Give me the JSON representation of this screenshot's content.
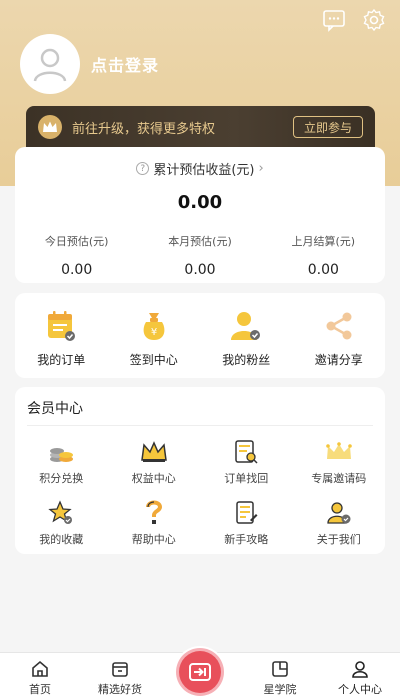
{
  "header": {
    "login_text": "点击登录",
    "icons": [
      "message-icon",
      "settings-icon"
    ]
  },
  "vip": {
    "text": "前往升级，获得更多特权",
    "button": "立即参与"
  },
  "earnings": {
    "title": "累计预估收益(元)",
    "total": "0.00",
    "cells": [
      {
        "label": "今日预估(元)",
        "value": "0.00"
      },
      {
        "label": "本月预估(元)",
        "value": "0.00"
      },
      {
        "label": "上月结算(元)",
        "value": "0.00"
      }
    ]
  },
  "quick": [
    {
      "label": "我的订单",
      "icon": "order-calendar-icon"
    },
    {
      "label": "签到中心",
      "icon": "money-bag-icon"
    },
    {
      "label": "我的粉丝",
      "icon": "fans-user-icon"
    },
    {
      "label": "邀请分享",
      "icon": "share-icon"
    }
  ],
  "member": {
    "title": "会员中心",
    "items": [
      {
        "label": "积分兑换",
        "icon": "coins-icon"
      },
      {
        "label": "权益中心",
        "icon": "crown-icon"
      },
      {
        "label": "订单找回",
        "icon": "order-search-icon"
      },
      {
        "label": "专属邀请码",
        "icon": "invite-crown-icon"
      },
      {
        "label": "我的收藏",
        "icon": "star-icon"
      },
      {
        "label": "帮助中心",
        "icon": "question-icon"
      },
      {
        "label": "新手攻略",
        "icon": "guide-icon"
      },
      {
        "label": "关于我们",
        "icon": "about-user-icon"
      }
    ]
  },
  "tabbar": {
    "items": [
      {
        "label": "首页",
        "icon": "home-icon"
      },
      {
        "label": "精选好货",
        "icon": "shop-icon"
      },
      {
        "label": "",
        "icon": "center-action-icon"
      },
      {
        "label": "星学院",
        "icon": "academy-icon"
      },
      {
        "label": "个人中心",
        "icon": "profile-icon",
        "active": true
      }
    ]
  },
  "colors": {
    "header_gold": "#e8cd98",
    "vip_dark": "#3c3226",
    "vip_gold_text": "#e7c98e",
    "accent_red": "#e8505b"
  }
}
